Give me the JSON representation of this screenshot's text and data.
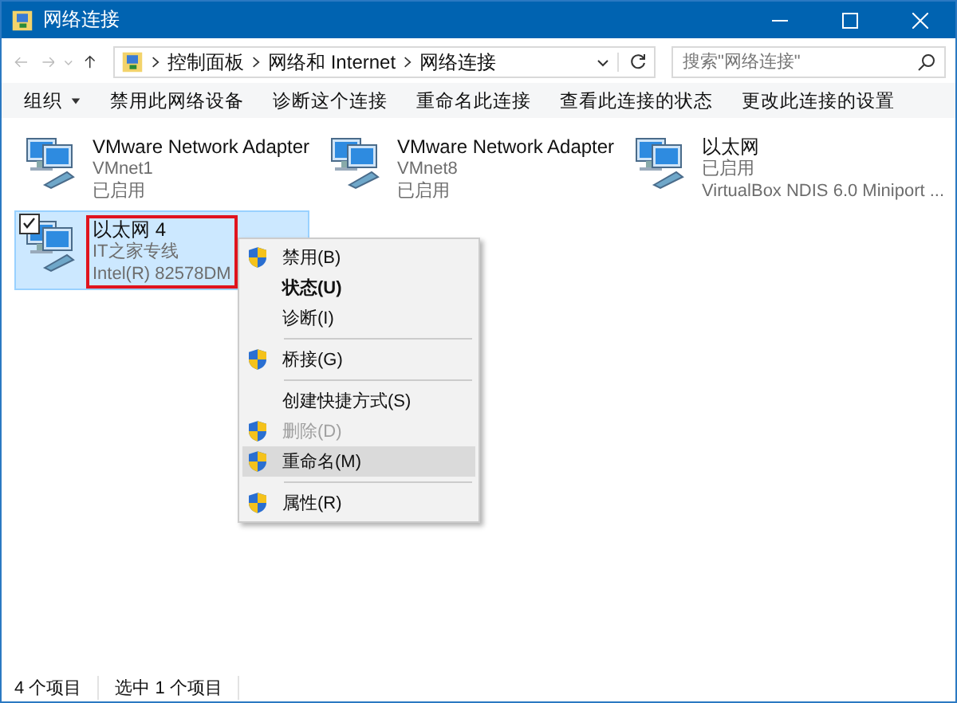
{
  "window": {
    "title": "网络连接"
  },
  "address": {
    "path": [
      "控制面板",
      "网络和 Internet",
      "网络连接"
    ],
    "search_placeholder": "搜索\"网络连接\""
  },
  "toolbar": {
    "organize": "组织",
    "commands": [
      "禁用此网络设备",
      "诊断这个连接",
      "重命名此连接",
      "查看此连接的状态",
      "更改此连接的设置"
    ]
  },
  "adapters": [
    {
      "name": "VMware Network Adapter",
      "lines": [
        "VMnet1",
        "已启用"
      ],
      "selected": false,
      "checked": false,
      "highlighted": false
    },
    {
      "name": "VMware Network Adapter",
      "lines": [
        "VMnet8",
        "已启用"
      ],
      "selected": false,
      "checked": false,
      "highlighted": false
    },
    {
      "name": "以太网",
      "lines": [
        "已启用",
        "VirtualBox NDIS 6.0 Miniport ..."
      ],
      "selected": false,
      "checked": false,
      "highlighted": false
    },
    {
      "name": "以太网 4",
      "lines": [
        "IT之家专线",
        "Intel(R) 82578DM"
      ],
      "selected": true,
      "checked": true,
      "highlighted": true
    }
  ],
  "context_menu": [
    {
      "kind": "item",
      "label": "禁用(B)",
      "shield": true,
      "bold": false,
      "disabled": false,
      "selected": false
    },
    {
      "kind": "item",
      "label": "状态(U)",
      "shield": false,
      "bold": true,
      "disabled": false,
      "selected": false
    },
    {
      "kind": "item",
      "label": "诊断(I)",
      "shield": false,
      "bold": false,
      "disabled": false,
      "selected": false
    },
    {
      "kind": "separator"
    },
    {
      "kind": "item",
      "label": "桥接(G)",
      "shield": true,
      "bold": false,
      "disabled": false,
      "selected": false
    },
    {
      "kind": "separator"
    },
    {
      "kind": "item",
      "label": "创建快捷方式(S)",
      "shield": false,
      "bold": false,
      "disabled": false,
      "selected": false
    },
    {
      "kind": "item",
      "label": "删除(D)",
      "shield": true,
      "bold": false,
      "disabled": true,
      "selected": false
    },
    {
      "kind": "item",
      "label": "重命名(M)",
      "shield": true,
      "bold": false,
      "disabled": false,
      "selected": true
    },
    {
      "kind": "separator"
    },
    {
      "kind": "item",
      "label": "属性(R)",
      "shield": true,
      "bold": false,
      "disabled": false,
      "selected": false
    }
  ],
  "status_bar": [
    "4 个项目",
    "选中 1 个项目"
  ]
}
